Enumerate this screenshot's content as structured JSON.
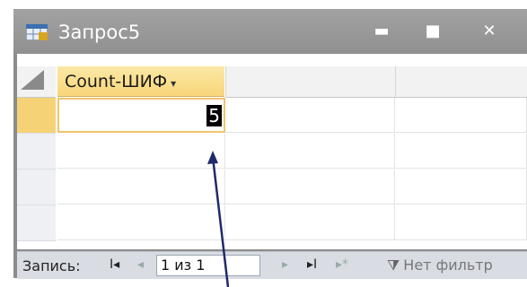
{
  "window": {
    "title": "Запрос5",
    "minimize_glyph": "▬",
    "maximize_glyph": "■",
    "close_glyph": "✕",
    "icon": "query-datasheet-icon"
  },
  "datasheet": {
    "column_header": "Count-ШИФ",
    "dropdown_glyph": "▾",
    "value": "5"
  },
  "navigation": {
    "record_label": "Запись:",
    "first_glyph": "I◂",
    "prev_glyph": "◂",
    "position": "1 из 1",
    "next_glyph": "▸",
    "last_glyph": "▸I",
    "new_glyph": "▸*",
    "filter_text": "Нет фильтр"
  },
  "colors": {
    "titlebar": "#949494",
    "header_active": "#f8d67a",
    "row_selector_active": "#f5d275",
    "arrow": "#1f2a6b"
  }
}
